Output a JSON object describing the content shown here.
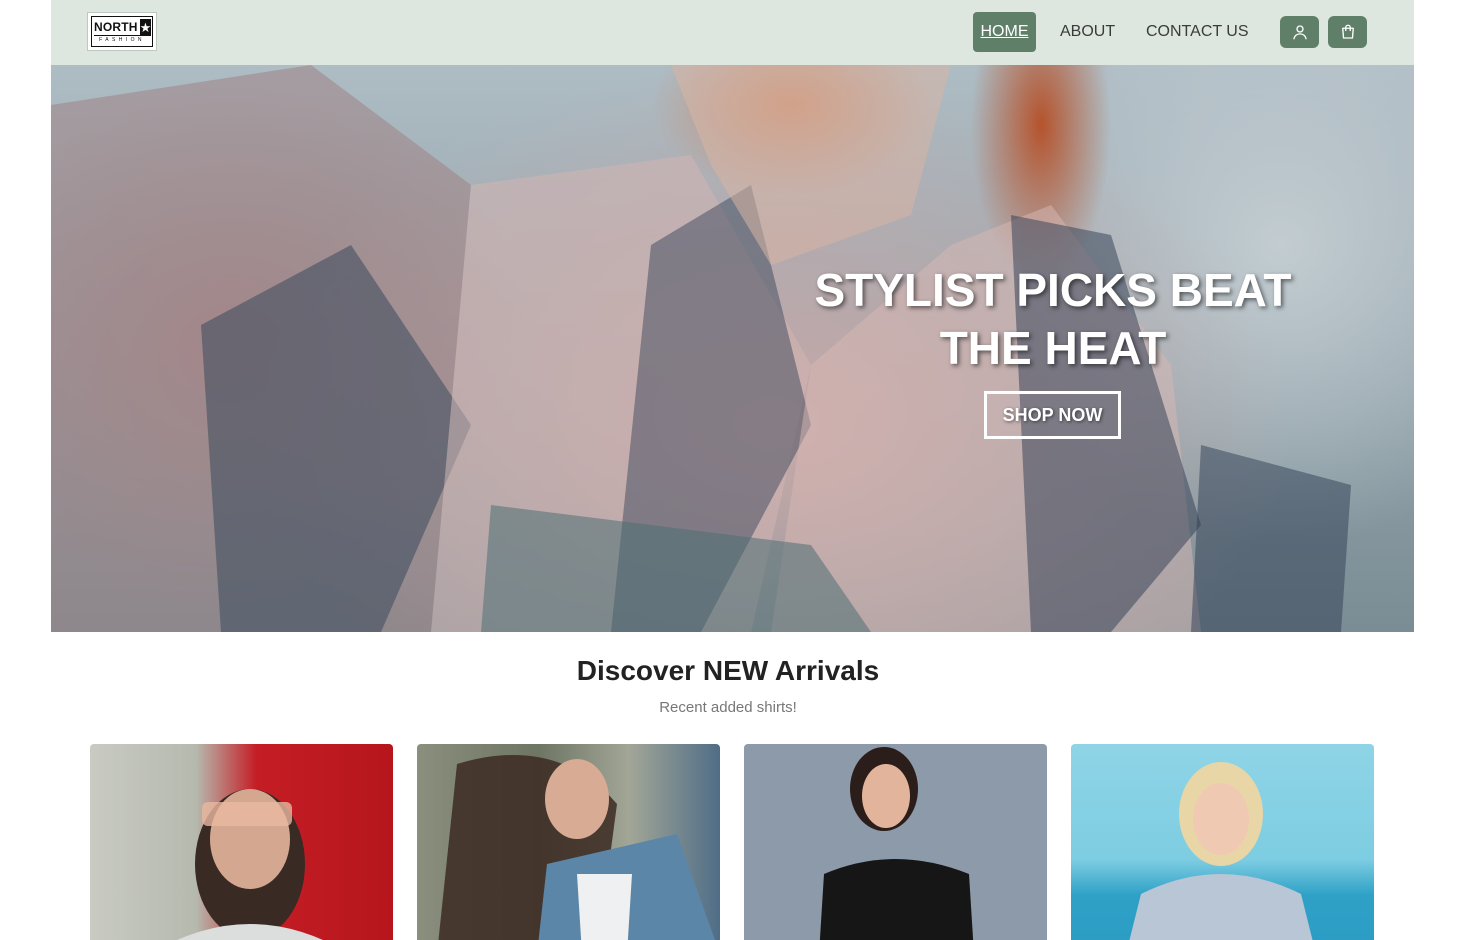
{
  "header": {
    "logo": {
      "word": "NORTH",
      "sub": "FASHION"
    },
    "nav": {
      "home": "HOME",
      "about": "ABOUT",
      "contact": "CONTACT US"
    },
    "icons": {
      "user": "user-icon",
      "cart": "shopping-bag-icon"
    }
  },
  "hero": {
    "title": "STYLIST PICKS BEAT THE HEAT",
    "cta": "SHOP NOW"
  },
  "section": {
    "title": "Discover NEW Arrivals",
    "subtitle": "Recent added shirts!"
  },
  "cards": [
    {
      "image": "woman-sunglasses-photo"
    },
    {
      "image": "woman-denim-jacket-photo"
    },
    {
      "image": "woman-black-polo-photo"
    },
    {
      "image": "woman-sweatshirt-photo"
    }
  ],
  "colors": {
    "header_bg": "#dde6df",
    "accent": "#5f7f68"
  }
}
